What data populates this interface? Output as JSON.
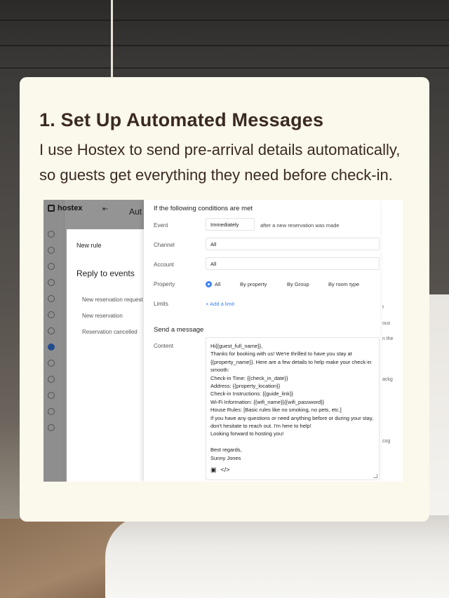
{
  "card": {
    "title": "1. Set Up Automated Messages",
    "body": "I use Hostex to send pre-arrival details automatically, so guests get everything they need before check-in."
  },
  "app": {
    "logo": "hostex",
    "collapse_icon": "collapse-icon",
    "page_title_fragment": "Aut"
  },
  "rule_panel": {
    "title": "New rule",
    "subtitle": "Reply to events",
    "events": [
      "New reservation request",
      "New reservation",
      "Reservation cancelled"
    ]
  },
  "form": {
    "conditions_heading": "If the following conditions are met",
    "event_label": "Event",
    "event_value": "Immediately",
    "event_suffix": "after a new reservation was made",
    "channel_label": "Channel",
    "channel_value": "All",
    "account_label": "Account",
    "account_value": "All",
    "property_label": "Property",
    "property_options": [
      "All",
      "By property",
      "By Group",
      "By room type"
    ],
    "property_selected": "All",
    "limits_label": "Limits",
    "add_limit": "+ Add a limit",
    "send_heading": "Send a message",
    "content_label": "Content",
    "content_lines": [
      "Hi{{guest_full_name}},",
      "Thanks for booking with us! We're thrilled to have you stay at",
      "{{property_name}}. Here are a few details to help make your check-in",
      "smooth:",
      "Check-in Time: {{check_in_date}}",
      "Address: {{property_location}}",
      "Check-in Instructions: {{guide_link}}",
      "Wi-Fi Information: {{wifi_name}}{{wifi_password}}",
      "House Rules: [Basic rules like no smoking, no pets, etc.]",
      "If you have any questions or need anything before or during your stay,",
      "don't hesitate to reach out. I'm here to help!",
      "Looking forward to hosting you!",
      "",
      "Best regards,",
      "Sunny Jones"
    ]
  },
  "right_strip": [
    "t",
    "ous",
    "n the",
    "ackg",
    "cog"
  ],
  "colors": {
    "accent": "#3b82f6",
    "card_bg": "#fbf8ec",
    "title_text": "#3a2a22"
  }
}
